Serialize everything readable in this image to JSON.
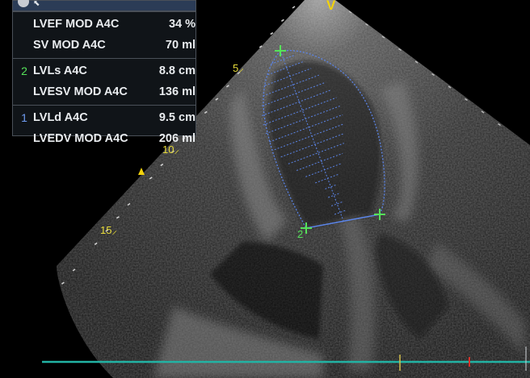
{
  "orientation_marker": "V",
  "depth_scale": {
    "labels": [
      "5",
      "10",
      "15"
    ]
  },
  "measurement_panel": {
    "groups": [
      {
        "index": "",
        "rows": [
          {
            "label": "LVEF MOD A4C",
            "value": "34 %"
          },
          {
            "label": "SV MOD A4C",
            "value": "70 ml"
          }
        ]
      },
      {
        "index": "2",
        "rows": [
          {
            "label": "LVLs A4C",
            "value": "8.8 cm"
          },
          {
            "label": "LVESV MOD A4C",
            "value": "136 ml"
          }
        ]
      },
      {
        "index": "1",
        "rows": [
          {
            "label": "LVLd A4C",
            "value": "9.5 cm"
          },
          {
            "label": "LVEDV MOD A4C",
            "value": "206 ml"
          }
        ]
      }
    ]
  },
  "trace": {
    "caliper_number": "2"
  },
  "colors": {
    "depth_marks": "#e8dc3a",
    "caliper": "#56e25a",
    "trace": "#5b84e6",
    "ecg_line": "#22b3a4",
    "group_index_2": "#56e25a",
    "group_index_1": "#6f9cf2"
  }
}
